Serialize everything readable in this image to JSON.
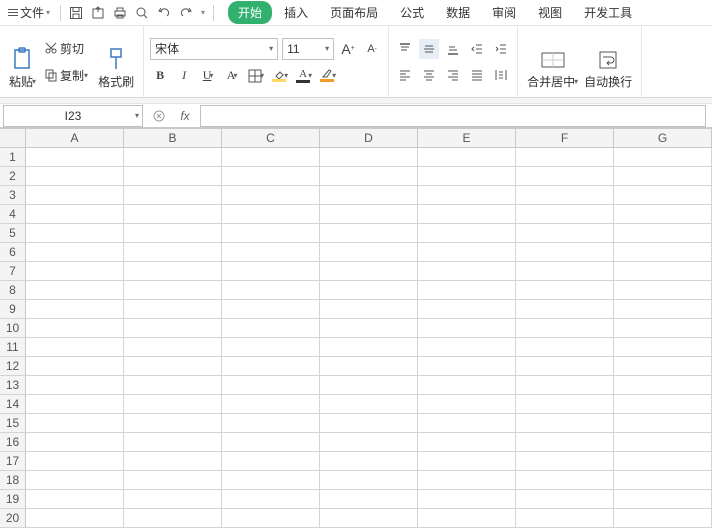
{
  "topbar": {
    "file_label": "文件"
  },
  "tabs": {
    "start": "开始",
    "insert": "插入",
    "pagelayout": "页面布局",
    "formula": "公式",
    "data": "数据",
    "review": "审阅",
    "view": "视图",
    "dev": "开发工具"
  },
  "ribbon": {
    "paste": "粘贴",
    "cut": "剪切",
    "copy": "复制",
    "formatpainter": "格式刷",
    "font_name": "宋体",
    "font_size": "11",
    "merge_center": "合并居中",
    "wrap": "自动换行"
  },
  "namebox": {
    "value": "I23"
  },
  "fx": {
    "value": ""
  },
  "columns": [
    "A",
    "B",
    "C",
    "D",
    "E",
    "F",
    "G"
  ],
  "rows": [
    "1",
    "2",
    "3",
    "4",
    "5",
    "6",
    "7",
    "8",
    "9",
    "10",
    "11",
    "12",
    "13",
    "14",
    "15",
    "16",
    "17",
    "18",
    "19",
    "20"
  ]
}
